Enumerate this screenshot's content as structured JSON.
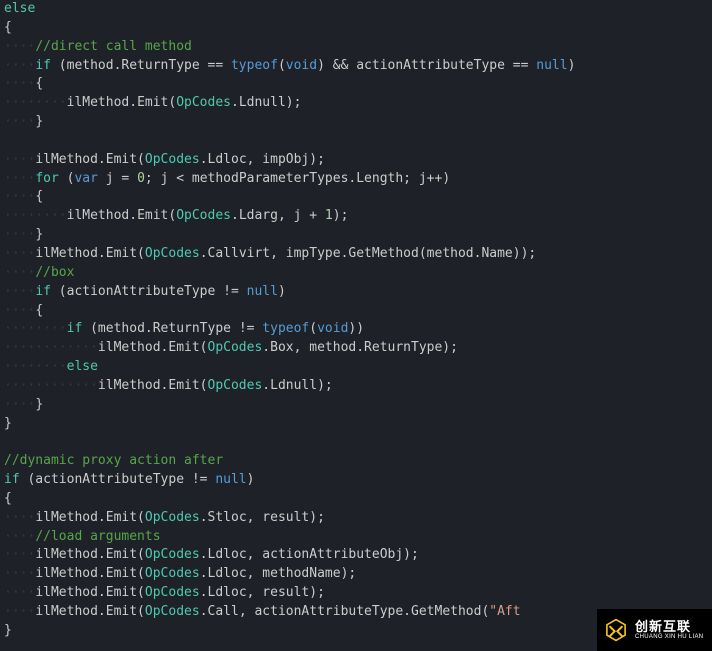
{
  "code": {
    "l1_else": "else",
    "l2_brace": "{",
    "l3_dots": "····",
    "l3_cm": "//direct call method",
    "l4_dots": "····",
    "l4_if": "if",
    "l4_a": " (method.ReturnType == ",
    "l4_typeof": "typeof",
    "l4_b": "(",
    "l4_void": "void",
    "l4_c": ") && actionAttributeType == ",
    "l4_null": "null",
    "l4_d": ")",
    "l5_dots": "····",
    "l5_brace": "{",
    "l6_dots": "········",
    "l6_a": "ilMethod.Emit(",
    "l6_op": "OpCodes",
    "l6_b": ".Ldnull);",
    "l7_dots": "····",
    "l7_brace": "}",
    "l9_dots": "····",
    "l9_a": "ilMethod.Emit(",
    "l9_op": "OpCodes",
    "l9_b": ".Ldloc, impObj);",
    "l10_dots": "····",
    "l10_for": "for",
    "l10_a": " (",
    "l10_var": "var",
    "l10_b": " j = ",
    "l10_zero": "0",
    "l10_c": "; j < methodParameterTypes.Length; j++)",
    "l11_dots": "····",
    "l11_brace": "{",
    "l12_dots": "········",
    "l12_a": "ilMethod.Emit(",
    "l12_op": "OpCodes",
    "l12_b": ".Ldarg, j + ",
    "l12_one": "1",
    "l12_c": ");",
    "l13_dots": "····",
    "l13_brace": "}",
    "l14_dots": "····",
    "l14_a": "ilMethod.Emit(",
    "l14_op": "OpCodes",
    "l14_b": ".Callvirt, impType.GetMethod(method.Name));",
    "l15_dots": "····",
    "l15_cm": "//box",
    "l16_dots": "····",
    "l16_if": "if",
    "l16_a": " (actionAttributeType != ",
    "l16_null": "null",
    "l16_b": ")",
    "l17_dots": "····",
    "l17_brace": "{",
    "l18_dots": "········",
    "l18_if": "if",
    "l18_a": " (method.ReturnType != ",
    "l18_typeof": "typeof",
    "l18_b": "(",
    "l18_void": "void",
    "l18_c": "))",
    "l19_dots": "············",
    "l19_a": "ilMethod.Emit(",
    "l19_op": "OpCodes",
    "l19_b": ".Box, method.ReturnType);",
    "l20_dots": "········",
    "l20_else": "else",
    "l21_dots": "············",
    "l21_a": "ilMethod.Emit(",
    "l21_op": "OpCodes",
    "l21_b": ".Ldnull);",
    "l22_dots": "····",
    "l22_brace": "}",
    "l23_brace": "}",
    "l25_cm": "//dynamic proxy action after",
    "l26_if": "if",
    "l26_a": " (actionAttributeType != ",
    "l26_null": "null",
    "l26_b": ")",
    "l27_brace": "{",
    "l28_dots": "····",
    "l28_a": "ilMethod.Emit(",
    "l28_op": "OpCodes",
    "l28_b": ".Stloc, result);",
    "l29_dots": "····",
    "l29_cm": "//load arguments",
    "l30_dots": "····",
    "l30_a": "ilMethod.Emit(",
    "l30_op": "OpCodes",
    "l30_b": ".Ldloc, actionAttributeObj);",
    "l31_dots": "····",
    "l31_a": "ilMethod.Emit(",
    "l31_op": "OpCodes",
    "l31_b": ".Ldloc, methodName);",
    "l32_dots": "····",
    "l32_a": "ilMethod.Emit(",
    "l32_op": "OpCodes",
    "l32_b": ".Ldloc, result);",
    "l33_dots": "····",
    "l33_a": "ilMethod.Emit(",
    "l33_op": "OpCodes",
    "l33_b": ".Call, actionAttributeType.GetMethod(",
    "l33_str": "\"Aft",
    "l34_brace": "}"
  },
  "logo": {
    "cn": "创新互联",
    "en": "CHUANG XIN HU LIAN"
  }
}
